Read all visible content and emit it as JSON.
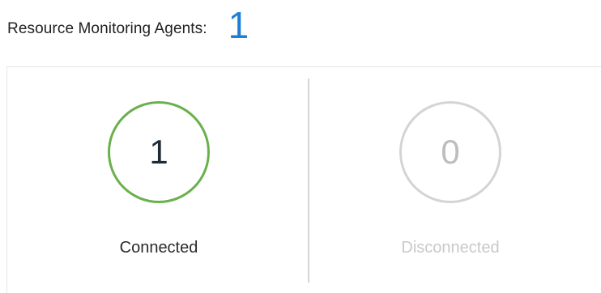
{
  "header": {
    "label": "Resource Monitoring Agents:",
    "count": "1",
    "accent_color": "#1f7fd6"
  },
  "stats": {
    "connected": {
      "value": "1",
      "label": "Connected",
      "ring_color": "#6ab04c"
    },
    "disconnected": {
      "value": "0",
      "label": "Disconnected",
      "ring_color": "#d4d4d4"
    }
  }
}
